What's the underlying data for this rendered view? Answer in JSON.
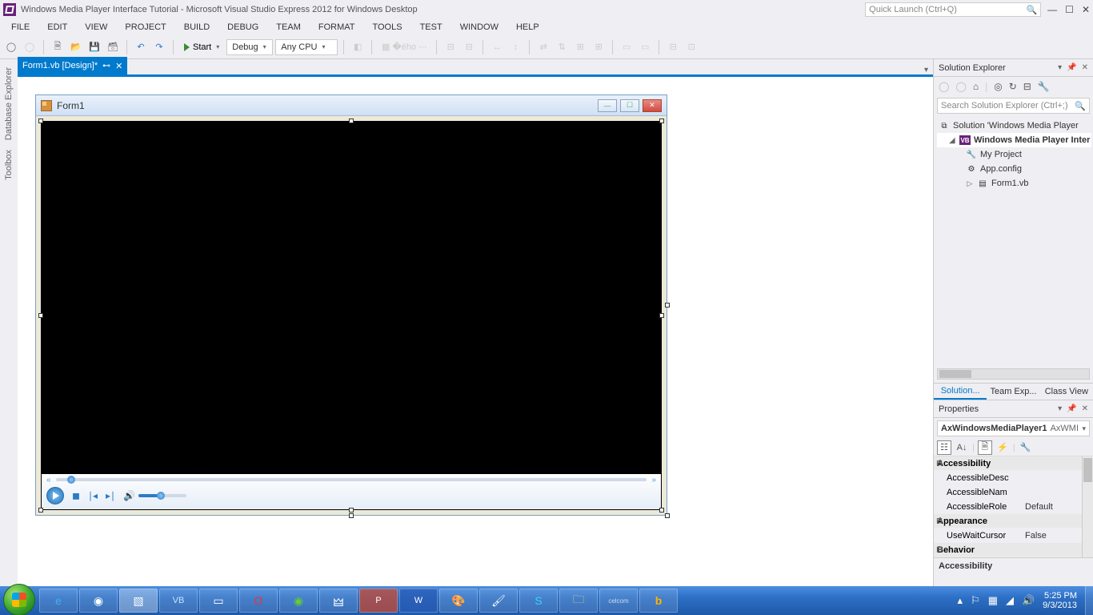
{
  "title": "Windows Media Player Interface Tutorial - Microsoft Visual Studio Express 2012 for Windows Desktop",
  "quicklaunch_placeholder": "Quick Launch (Ctrl+Q)",
  "menus": [
    "FILE",
    "EDIT",
    "VIEW",
    "PROJECT",
    "BUILD",
    "DEBUG",
    "TEAM",
    "FORMAT",
    "TOOLS",
    "TEST",
    "WINDOW",
    "HELP"
  ],
  "toolbar": {
    "start": "Start",
    "config": "Debug",
    "platform": "Any CPU"
  },
  "left_panels": [
    "Database Explorer",
    "Toolbox"
  ],
  "doc_tab": "Form1.vb [Design]*",
  "form_title": "Form1",
  "solution_explorer": {
    "title": "Solution Explorer",
    "search_placeholder": "Search Solution Explorer (Ctrl+;)",
    "solution": "Solution 'Windows Media Player",
    "project": "Windows Media Player Inter",
    "items": [
      "My Project",
      "App.config",
      "Form1.vb"
    ],
    "tabs": [
      "Solution...",
      "Team Exp...",
      "Class View"
    ]
  },
  "properties": {
    "title": "Properties",
    "object": "AxWindowsMediaPlayer1",
    "object_type": "AxWMI",
    "cats": [
      {
        "name": "Accessibility",
        "rows": [
          {
            "k": "AccessibleDesc",
            "v": ""
          },
          {
            "k": "AccessibleNam",
            "v": ""
          },
          {
            "k": "AccessibleRole",
            "v": "Default"
          }
        ]
      },
      {
        "name": "Appearance",
        "rows": [
          {
            "k": "UseWaitCursor",
            "v": "False"
          }
        ]
      },
      {
        "name": "Behavior",
        "rows": []
      }
    ],
    "desc_title": "Accessibility"
  },
  "taskbar": {
    "time": "5:25 PM",
    "date": "9/3/2013"
  }
}
